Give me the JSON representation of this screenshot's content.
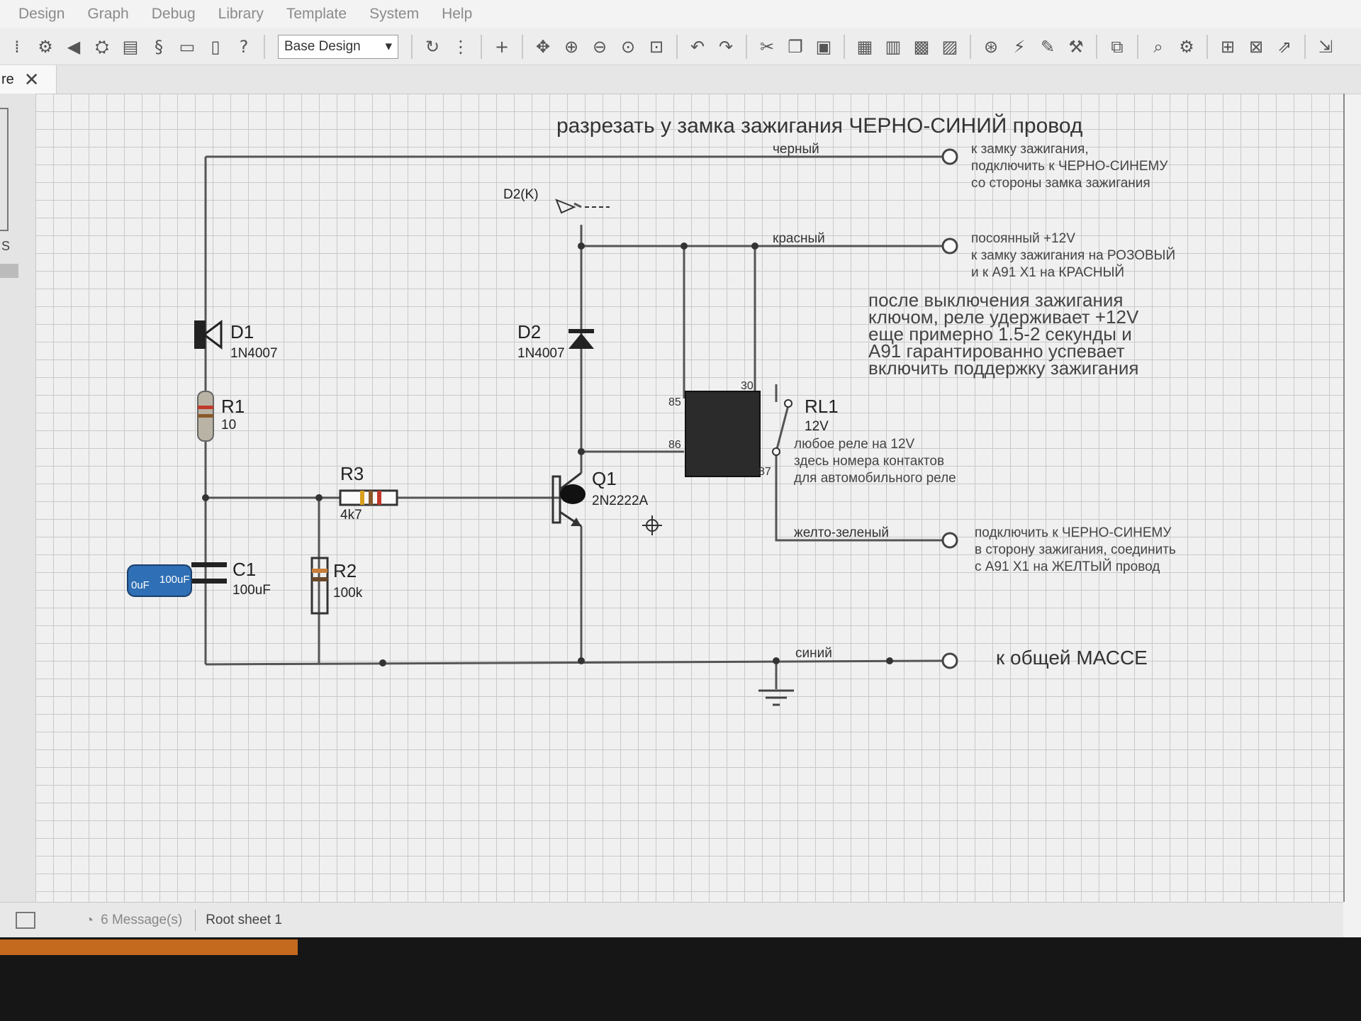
{
  "menu": [
    "Design",
    "Graph",
    "Debug",
    "Library",
    "Template",
    "System",
    "Help"
  ],
  "toolbar": {
    "design_select": "Base Design",
    "left_icons": [
      "component-mode-icon",
      "chip-icon",
      "back-icon",
      "device-icon",
      "list-icon",
      "script-icon",
      "tape-icon",
      "doc-icon",
      "help-icon"
    ],
    "right_icons": [
      "refresh-icon",
      "grid-icon",
      "origin-icon",
      "pan-icon",
      "zoom-in-icon",
      "zoom-out-icon",
      "zoom-fit-icon",
      "zoom-area-icon",
      "undo-icon",
      "redo-icon",
      "cut-icon",
      "copy-icon",
      "paste-icon",
      "block-copy-icon",
      "block-move-icon",
      "block-rotate-icon",
      "block-delete-icon",
      "pick-icon",
      "wire-autoroute-icon",
      "search-tag-icon",
      "property-icon",
      "netlist-icon",
      "find-icon",
      "tool-icon",
      "new-sheet-icon",
      "remove-sheet-icon",
      "child-sheet-icon",
      "export-icon"
    ]
  },
  "tab": {
    "label": "re"
  },
  "left_panel": {
    "label": "S"
  },
  "schematic": {
    "title": "разрезать у замка зажигания ЧЕРНО-СИНИЙ провод",
    "wires": {
      "black": "черный",
      "red": "красный",
      "yellow_green": "желто-зеленый",
      "blue": "синий"
    },
    "notes": {
      "n1": [
        "к замку зажигания,",
        "подключить к ЧЕРНО-СИНЕМУ",
        "со стороны замка зажигания"
      ],
      "n2": [
        "посоянный +12V",
        "к замку зажигания на РОЗОВЫЙ",
        "и к А91 Х1 на КРАСНЫЙ"
      ],
      "n3": [
        "после выключения зажигания",
        "ключом, реле удерживает +12V",
        "еще примерно 1.5-2 секунды и",
        "А91 гарантированно успевает",
        "включить поддержку зажигания"
      ],
      "n4": [
        "любое реле на 12V",
        "здесь номера контактов",
        "для автомобильного реле"
      ],
      "n5": [
        "подключить к ЧЕРНО-СИНЕМУ",
        "в сторону зажигания, соединить",
        "с А91 Х1 на ЖЕЛТЫЙ провод"
      ],
      "ground": "к общей МАССЕ"
    },
    "components": {
      "d1": {
        "ref": "D1",
        "value": "1N4007"
      },
      "d2": {
        "ref": "D2",
        "value": "1N4007",
        "probe": "D2(K)"
      },
      "r1": {
        "ref": "R1",
        "value": "10"
      },
      "r2": {
        "ref": "R2",
        "value": "100k"
      },
      "r3": {
        "ref": "R3",
        "value": "4k7"
      },
      "c1": {
        "ref": "C1",
        "value": "100uF",
        "body_text": "100uF",
        "body_text2": "0uF"
      },
      "q1": {
        "ref": "Q1",
        "value": "2N2222A"
      },
      "rl1": {
        "ref": "RL1",
        "value": "12V",
        "pins": [
          "30",
          "85",
          "86",
          "87"
        ]
      }
    }
  },
  "status": {
    "messages": "6 Message(s)",
    "sheet": "Root sheet 1"
  },
  "colors": {
    "wire": "#555555",
    "component": "#222222",
    "capacitor": "#2f6fb5",
    "grid": "#c9c9c9"
  }
}
